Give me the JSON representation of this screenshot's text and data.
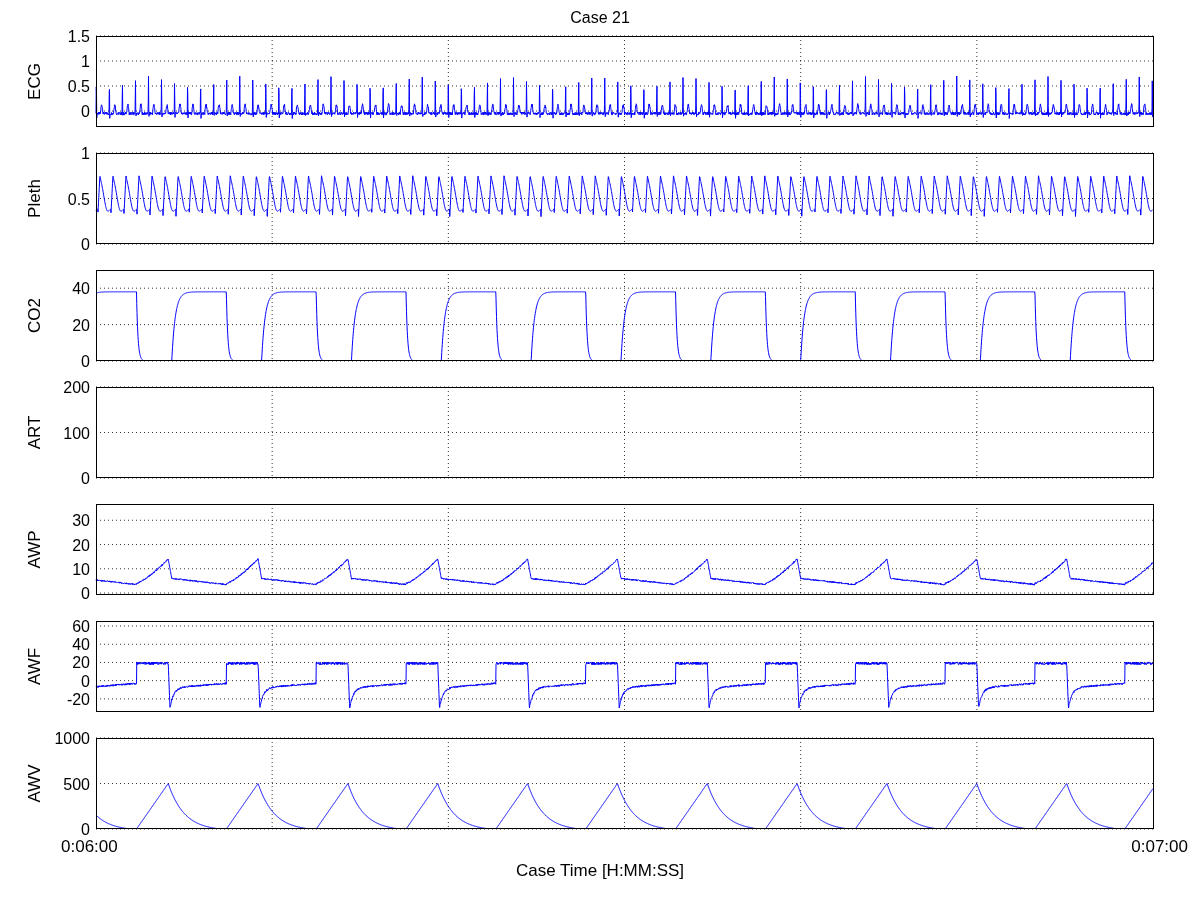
{
  "title": "Case 21",
  "panels": [
    {
      "kind": "ecg",
      "ylabel": "ECG",
      "yticks": [
        "1.5",
        "1",
        "0.5",
        "0"
      ]
    },
    {
      "kind": "pleth",
      "ylabel": "Pleth",
      "yticks": [
        "1",
        "0.5",
        "0"
      ]
    },
    {
      "kind": "co2",
      "ylabel": "CO2",
      "yticks": [
        "40",
        "20",
        "0"
      ]
    },
    {
      "kind": "art",
      "ylabel": "ART",
      "yticks": [
        "200",
        "100",
        "0"
      ]
    },
    {
      "kind": "awp",
      "ylabel": "AWP",
      "yticks": [
        "30",
        "20",
        "10",
        "0"
      ]
    },
    {
      "kind": "awf",
      "ylabel": "AWF",
      "yticks": [
        "60",
        "40",
        "20",
        "0",
        "-20"
      ]
    },
    {
      "kind": "awv",
      "ylabel": "AWV",
      "yticks": [
        "1000",
        "500",
        "0"
      ]
    }
  ],
  "xaxis": {
    "ticks": [
      "0:06:00",
      "0:07:00"
    ],
    "label": "Case Time [H:MM:SS]"
  }
}
